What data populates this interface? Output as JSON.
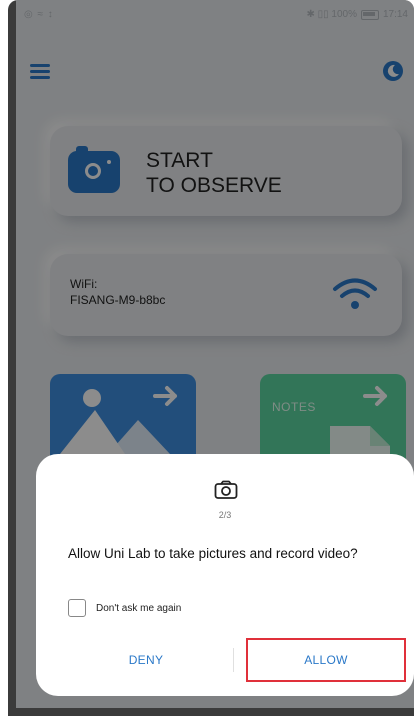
{
  "status_bar": {
    "left_icons": "◎ ≈ ↕",
    "right_text": "✱ ▯▯ 100%",
    "time": "17:14"
  },
  "header": {
    "menu_icon": "hamburger-menu-icon",
    "theme_icon": "moon-icon"
  },
  "observe_card": {
    "line1": "START",
    "line2": "TO OBSERVE",
    "icon": "camera-icon"
  },
  "wifi_card": {
    "label": "WiFi:",
    "ssid": "FISANG-M9-b8bc",
    "icon": "wifi-icon"
  },
  "tiles": {
    "gallery_icon": "image-icon",
    "notes_label": "NOTES",
    "notes_icon": "document-icon"
  },
  "dialog": {
    "icon": "camera-icon",
    "step": "2/3",
    "message": "Allow Uni Lab to take pictures and record video?",
    "checkbox_label": "Don't ask me again",
    "checkbox_checked": false,
    "deny_label": "DENY",
    "allow_label": "ALLOW"
  },
  "colors": {
    "accent_blue": "#2a78c8",
    "gallery_tile": "#3f8fe0",
    "notes_tile": "#5bd6a0",
    "highlight_red": "#e0303a"
  }
}
